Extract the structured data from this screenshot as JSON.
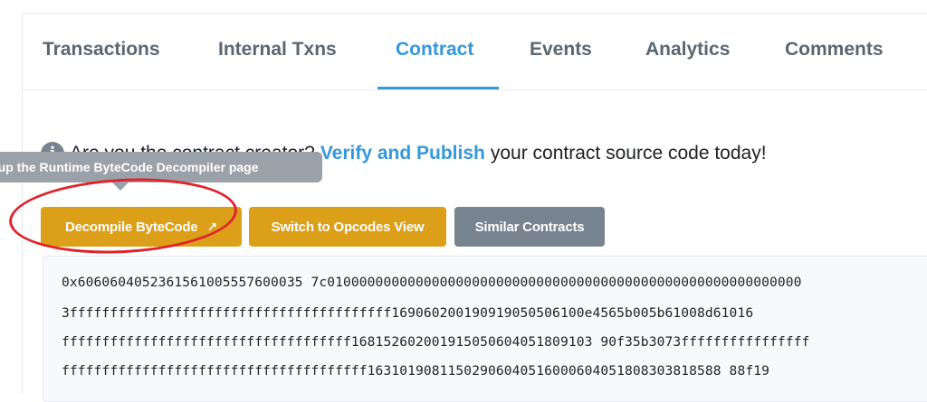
{
  "tabs": [
    {
      "label": "Transactions"
    },
    {
      "label": "Internal Txns"
    },
    {
      "label": "Contract",
      "active": true
    },
    {
      "label": "Events"
    },
    {
      "label": "Analytics"
    },
    {
      "label": "Comments"
    }
  ],
  "notice": {
    "prefix": "Are you the contract creator?",
    "link": "Verify and Publish",
    "suffix": "your contract source code today!",
    "icon": "info-icon"
  },
  "tooltip": {
    "text": "Open up the Runtime ByteCode Decompiler page"
  },
  "buttons": {
    "decompile": "Decompile ByteCode",
    "opcodes": "Switch to Opcodes View",
    "similar": "Similar Contracts"
  },
  "bytecode": {
    "lines": [
      "0x6060604052361561005557600035 7c01000000000000000000000000000000000000000000000000000000000",
      "3ffffffffffffffffffffffffffffffffffffffff169060200190919050506100e4565b005b61008d61016",
      "ffffffffffffffffffffffffffffffffffff168152602001915050604051809103 90f35b3073ffffffffffffffff",
      "ffffffffffffffffffffffffffffffffffffff16310190811502906040516000604051808303818588 88f19"
    ]
  },
  "colors": {
    "accent": "#3498db",
    "warning_button": "#dc9f1a",
    "secondary_button": "#77838f",
    "annotation_circle": "#e0232a"
  }
}
